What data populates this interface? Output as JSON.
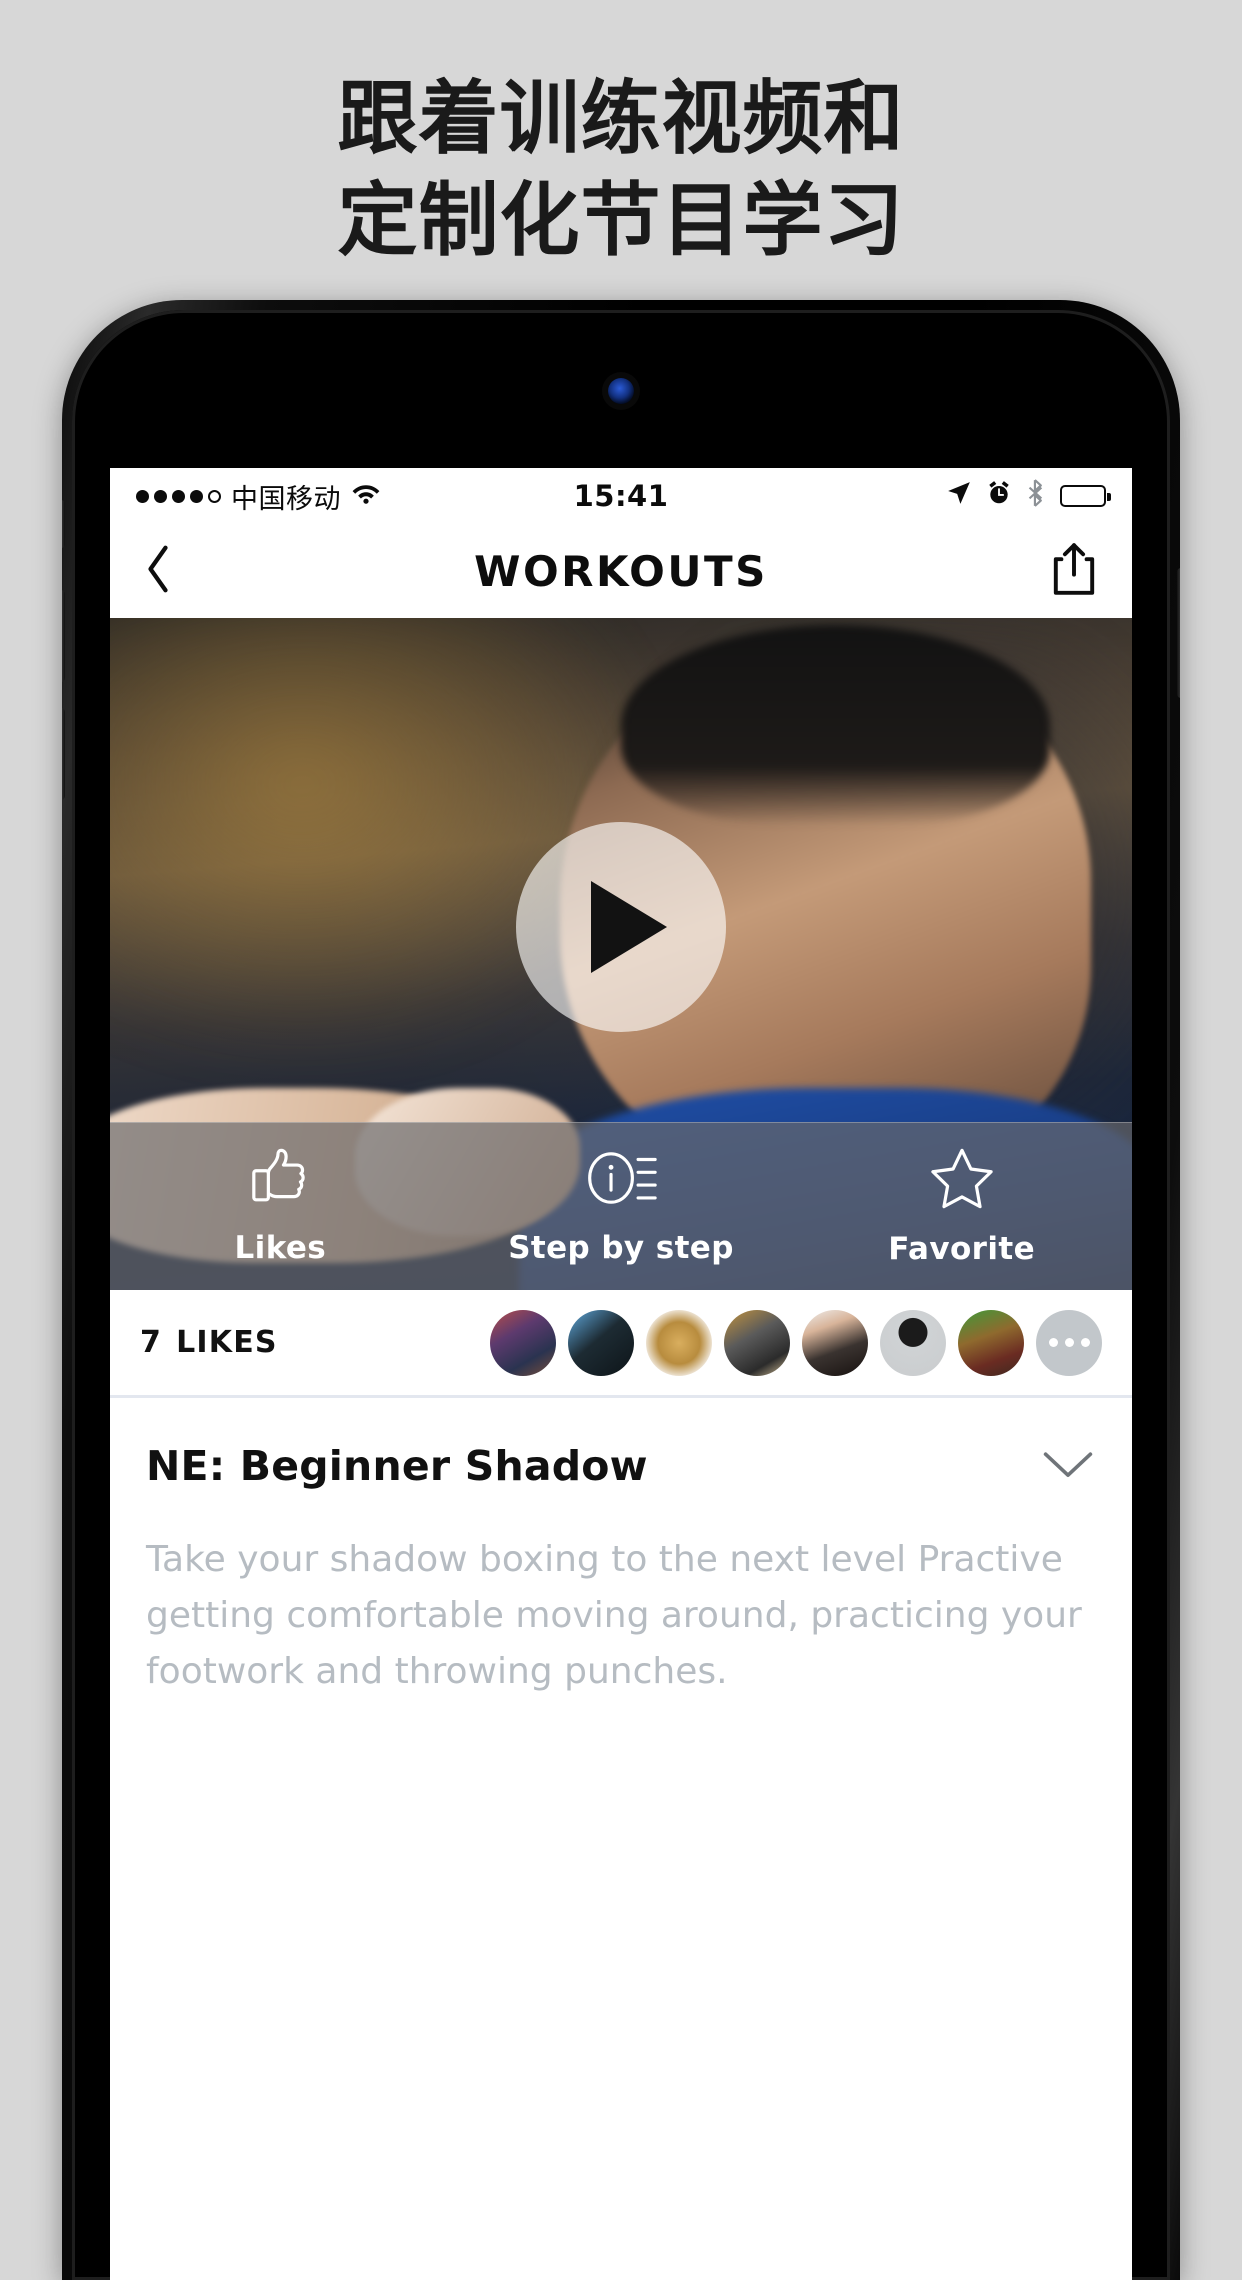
{
  "headline": {
    "line1": "跟着训练视频和",
    "line2": "定制化节目学习"
  },
  "status_bar": {
    "signal_dots_filled": 4,
    "signal_dots_total": 5,
    "carrier": "中国移动",
    "wifi_icon": "wifi-icon",
    "time": "15:41",
    "location_icon": "location-arrow-icon",
    "alarm_icon": "alarm-clock-icon",
    "bluetooth_icon": "bluetooth-icon",
    "battery_icon": "battery-icon",
    "battery_percent": 70
  },
  "navbar": {
    "back_icon": "chevron-left-icon",
    "title": "WORKOUTS",
    "share_icon": "share-icon"
  },
  "hero": {
    "play_icon": "play-icon"
  },
  "action_bar": {
    "items": [
      {
        "label": "Likes",
        "icon": "thumbs-up-icon"
      },
      {
        "label": "Step by step",
        "icon": "info-list-icon"
      },
      {
        "label": "Favorite",
        "icon": "star-icon"
      }
    ]
  },
  "likes": {
    "count": "7",
    "label": "LIKES",
    "more_icon": "ellipsis-icon",
    "avatars": [
      {
        "name": "avatar-1"
      },
      {
        "name": "avatar-2"
      },
      {
        "name": "avatar-3"
      },
      {
        "name": "avatar-4"
      },
      {
        "name": "avatar-5"
      },
      {
        "name": "avatar-6"
      },
      {
        "name": "avatar-7"
      }
    ]
  },
  "detail": {
    "title": "NE: Beginner Shadow",
    "expand_icon": "chevron-down-icon",
    "description": "Take your shadow boxing to the next level Practive getting comfortable moving around, practicing your footwork and throwing punches."
  },
  "colors": {
    "page_bg": "#d7d7d7",
    "headline": "#1a1a1a",
    "screen_bg": "#ffffff",
    "muted_text": "#b6bcc2",
    "action_overlay": "rgba(105,105,108,0.68)"
  }
}
